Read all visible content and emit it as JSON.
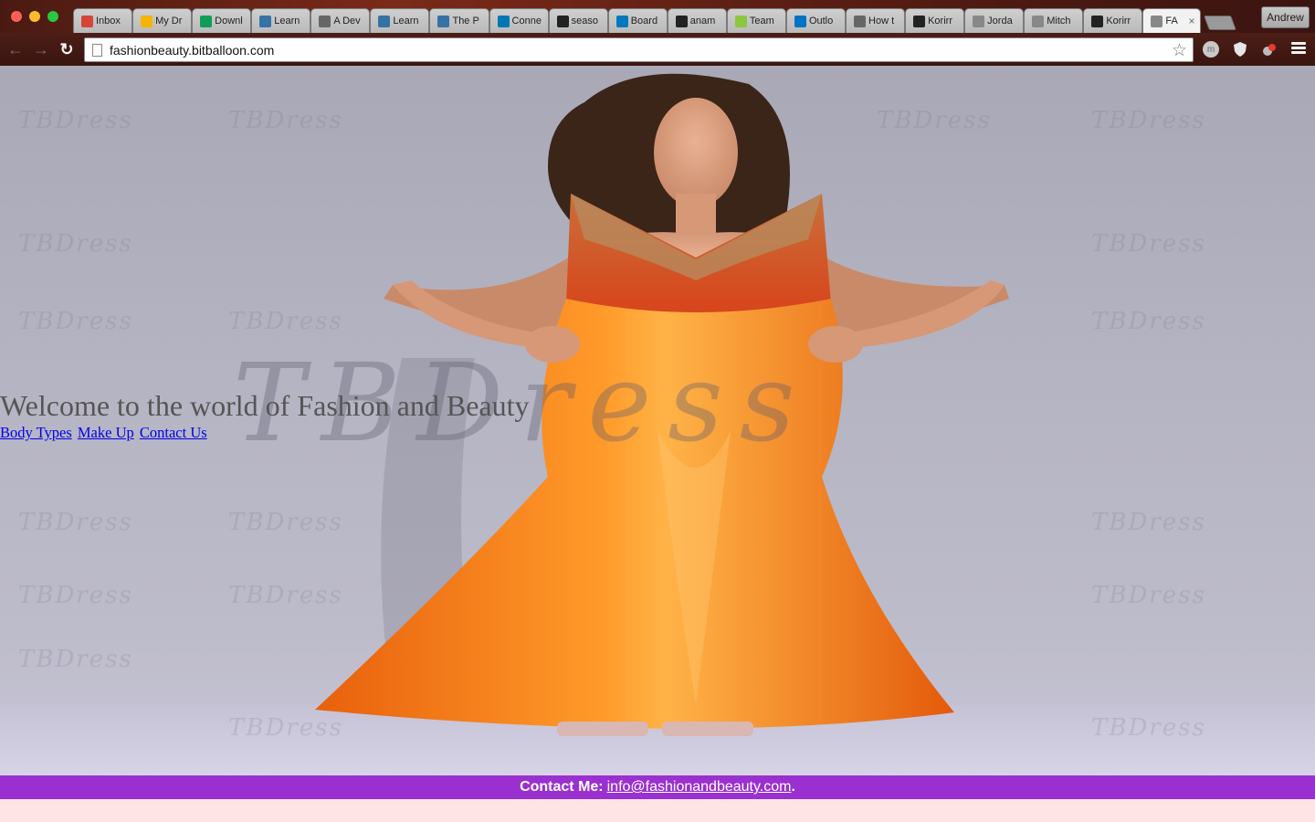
{
  "browser": {
    "profile_name": "Andrew",
    "url": "fashionbeauty.bitballoon.com",
    "tabs": [
      {
        "label": "Inbox",
        "favicon": "gmail-icon",
        "color": "#d44638"
      },
      {
        "label": "My Dr",
        "favicon": "drive-icon",
        "color": "#f4b400"
      },
      {
        "label": "Downl",
        "favicon": "drive-icon",
        "color": "#0f9d58"
      },
      {
        "label": "Learn",
        "favicon": "python-icon",
        "color": "#3572a5"
      },
      {
        "label": "A Dev",
        "favicon": "page-icon",
        "color": "#666666"
      },
      {
        "label": "Learn",
        "favicon": "python-icon",
        "color": "#3572a5"
      },
      {
        "label": "The P",
        "favicon": "python-icon",
        "color": "#3572a5"
      },
      {
        "label": "Conne",
        "favicon": "linkedin-icon",
        "color": "#0077b5"
      },
      {
        "label": "seaso",
        "favicon": "github-icon",
        "color": "#222222"
      },
      {
        "label": "Board",
        "favicon": "trello-icon",
        "color": "#0079bf"
      },
      {
        "label": "anam",
        "favicon": "github-icon",
        "color": "#222222"
      },
      {
        "label": "Team",
        "favicon": "meetup-icon",
        "color": "#8dc63f"
      },
      {
        "label": "Outlo",
        "favicon": "outlook-icon",
        "color": "#0072c6"
      },
      {
        "label": "How t",
        "favicon": "page-icon",
        "color": "#666666"
      },
      {
        "label": "Korirr",
        "favicon": "github-icon",
        "color": "#222222"
      },
      {
        "label": "Jorda",
        "favicon": "page-icon",
        "color": "#888888"
      },
      {
        "label": "Mitch",
        "favicon": "page-icon",
        "color": "#888888"
      },
      {
        "label": "Korirr",
        "favicon": "github-icon",
        "color": "#222222"
      },
      {
        "label": "FA",
        "favicon": "page-icon",
        "color": "#888888",
        "active": true
      }
    ]
  },
  "page": {
    "heading": "Welcome to the world of Fashion and Beauty",
    "nav": {
      "body_types": "Body Types",
      "make_up": "Make Up",
      "contact_us": "Contact Us"
    },
    "watermark": "TBDress",
    "footer": {
      "label": "Contact Me:",
      "email": "info@fashionandbeauty.com",
      "trail": "."
    }
  },
  "colors": {
    "footer_bg": "#9b30d0",
    "page_bg": "#ffe4e6",
    "link": "#0000ee",
    "dress": "#f47a1a"
  }
}
